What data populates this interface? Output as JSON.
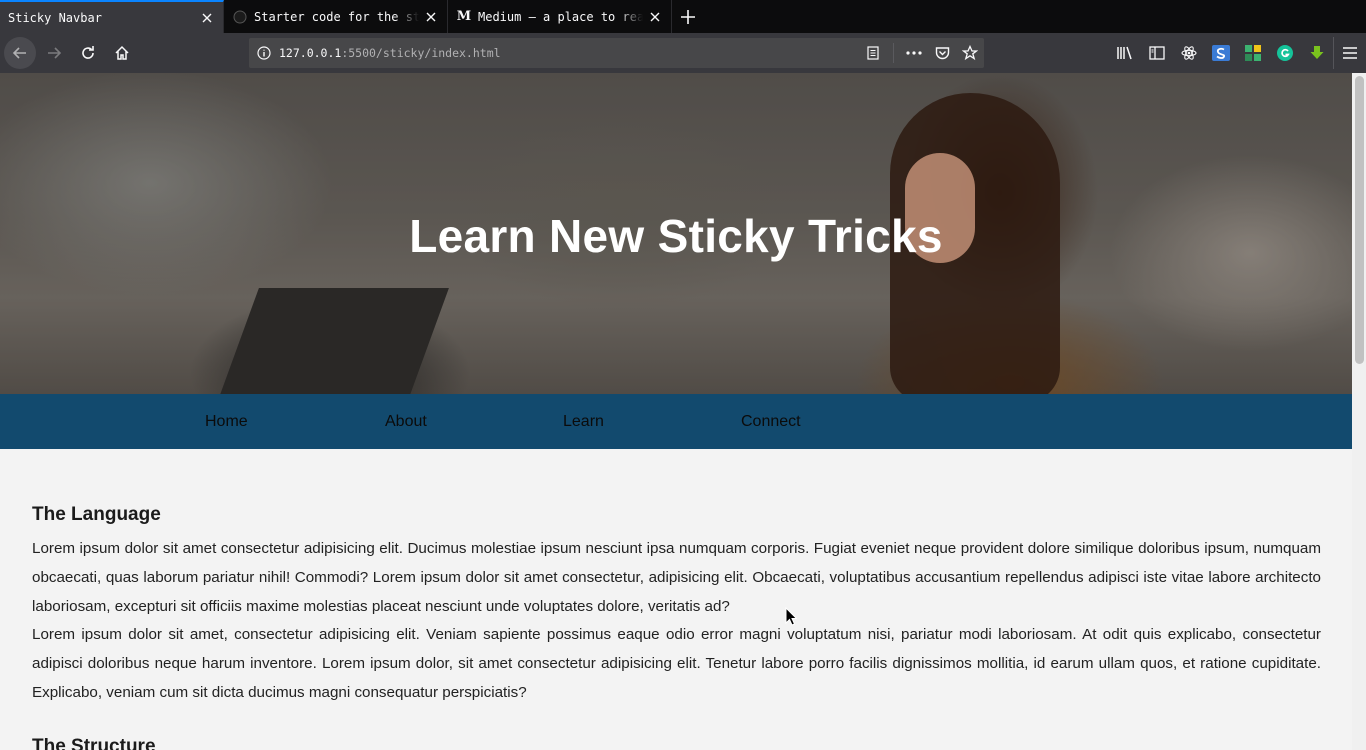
{
  "browser": {
    "tabs": [
      {
        "title": "Sticky Navbar",
        "favicon": "none",
        "active": true
      },
      {
        "title": "Starter code for the sticky",
        "favicon": "github-icon",
        "active": false
      },
      {
        "title": "Medium – a place to read",
        "favicon": "medium-icon",
        "favicon_text": "M",
        "active": false
      }
    ],
    "url": {
      "host": "127.0.0.1",
      "path": ":5500/sticky/index.html"
    },
    "accent_color": "#0a84ff"
  },
  "page": {
    "hero_title": "Learn New Sticky Tricks",
    "nav": {
      "items": [
        "Home",
        "About",
        "Learn",
        "Connect"
      ],
      "background": "#124a6e"
    },
    "sections": [
      {
        "heading": "The Language",
        "paragraphs": [
          "Lorem ipsum dolor sit amet consectetur adipisicing elit. Ducimus molestiae ipsum nesciunt ipsa numquam corporis. Fugiat eveniet neque provident dolore similique doloribus ipsum, numquam obcaecati, quas laborum pariatur nihil! Commodi? Lorem ipsum dolor sit amet consectetur, adipisicing elit. Obcaecati, voluptatibus accusantium repellendus adipisci iste vitae labore architecto laboriosam, excepturi sit officiis maxime molestias placeat nesciunt unde voluptates dolore, veritatis ad?",
          "Lorem ipsum dolor sit amet, consectetur adipisicing elit. Veniam sapiente possimus eaque odio error magni voluptatum nisi, pariatur modi laboriosam. At odit quis explicabo, consectetur adipisci doloribus neque harum inventore. Lorem ipsum dolor, sit amet consectetur adipisicing elit. Tenetur labore porro facilis dignissimos mollitia, id earum ullam quos, et ratione cupiditate. Explicabo, veniam cum sit dicta ducimus magni consequatur perspiciatis?"
        ]
      },
      {
        "heading": "The Structure"
      }
    ]
  }
}
